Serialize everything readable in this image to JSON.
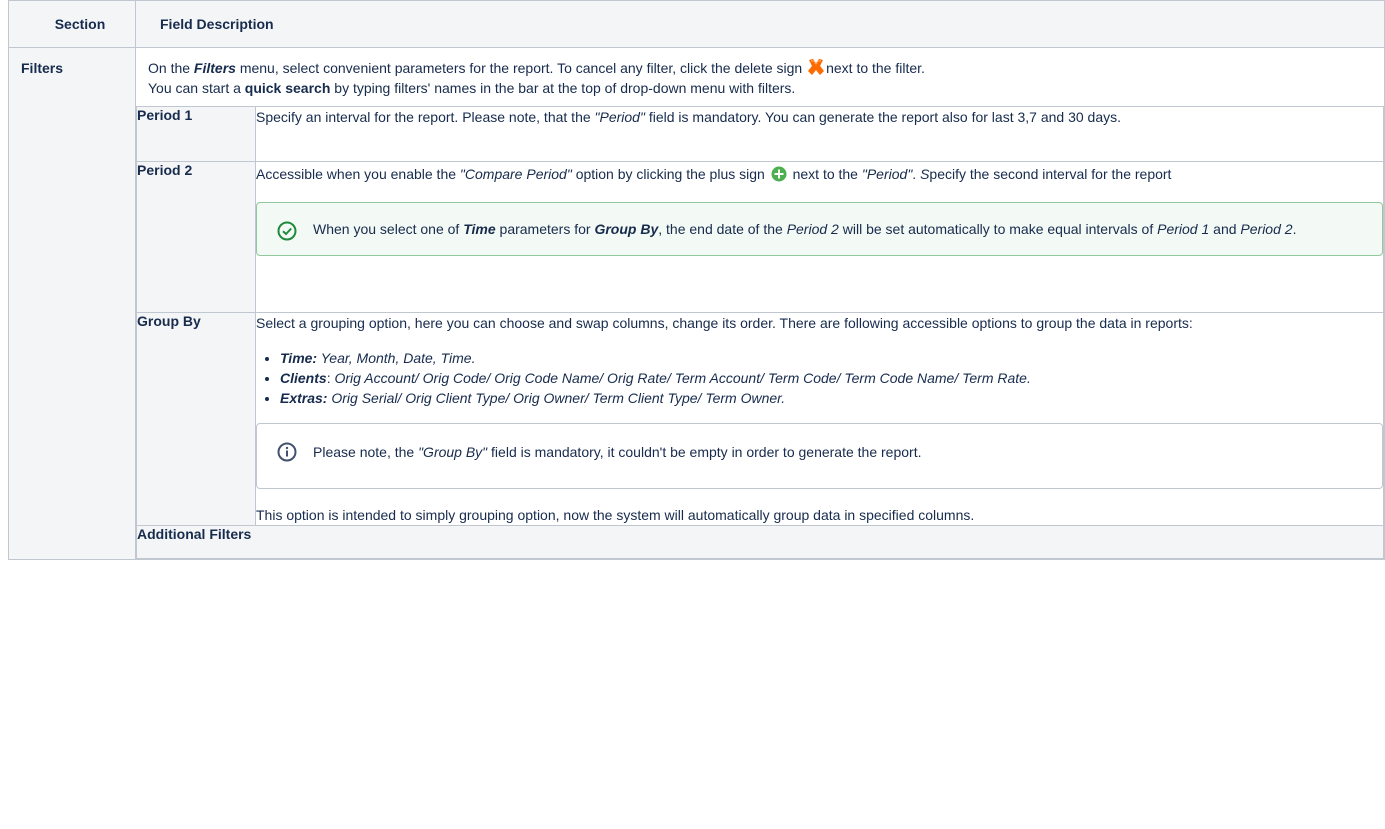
{
  "headers": {
    "section": "Section",
    "field": "Field Description"
  },
  "filters": {
    "label": "Filters",
    "intro": {
      "p1a": "On the ",
      "p1b": "Filters",
      "p1c": " menu, select convenient parameters for the report. To cancel any filter, click the delete sign ",
      "p1d": "next to the filter.",
      "p2a": "You can start a ",
      "p2b": "quick search",
      "p2c": " by typing filters' names in the bar at the top of drop-down menu with filters."
    },
    "rows": [
      {
        "label": "Period 1",
        "t1": "Specify an interval for the report. Please note, that the ",
        "t2": "\"Period\"",
        "t3": " field is mandatory. You can generate the report also for last 3,7 and 30 days."
      },
      {
        "label": "Period 2",
        "t1": "Accessible when you enable the ",
        "t2": "\"Compare Period\"",
        "t3": " option by clicking the plus sign ",
        "t4": " next to the ",
        "t5": "\"Period\"",
        "t6": ". ",
        "t7": "S",
        "t8": "pecify the second interval for the report",
        "panel": {
          "a": "When you select one of ",
          "b": "Time",
          "c": " parameters for ",
          "d": "Group By",
          "e": ", the end date of the ",
          "f": "Period 2",
          "g": " will be set automatically to make equal intervals of ",
          "h": "Period 1",
          "i": " and ",
          "j": "Period 2",
          "k": "."
        }
      },
      {
        "label": "Group By",
        "intro": "Select a grouping option, here you can choose and swap columns, change its order. There are following accessible options to group the data in reports:",
        "bullets": [
          {
            "head": "Time:",
            "text": " Year, Month, Date, Time."
          },
          {
            "head": "Clients",
            "sep": ": ",
            "text": "Orig Account/ Orig Code/ Orig Code Name/ Orig Rate/ Term Account/ Term Code/ Term Code Name/ Term Rate."
          },
          {
            "head": "Extras:",
            "text": " Orig Serial/ Orig Client Type/ Orig Owner/ Term Client Type/ Term Owner."
          }
        ],
        "panel": {
          "a": "Please note, the ",
          "b": "\"Group By\"",
          "c": " field is mandatory, it couldn't be empty in order to generate the report."
        },
        "outro": "This option is intended to simply grouping option, now the system will automatically group data in specified columns."
      }
    ],
    "additional": "Additional Filters"
  },
  "icons": {
    "delete": "delete-x-icon",
    "plus": "plus-circle-icon",
    "check": "check-circle-icon",
    "info": "info-circle-icon"
  },
  "colors": {
    "delete_icon": "#ff6a00",
    "plus_icon": "#4caf50",
    "success_border": "#91c89c",
    "success_icon": "#1f8a3b",
    "info_icon": "#42526e"
  }
}
